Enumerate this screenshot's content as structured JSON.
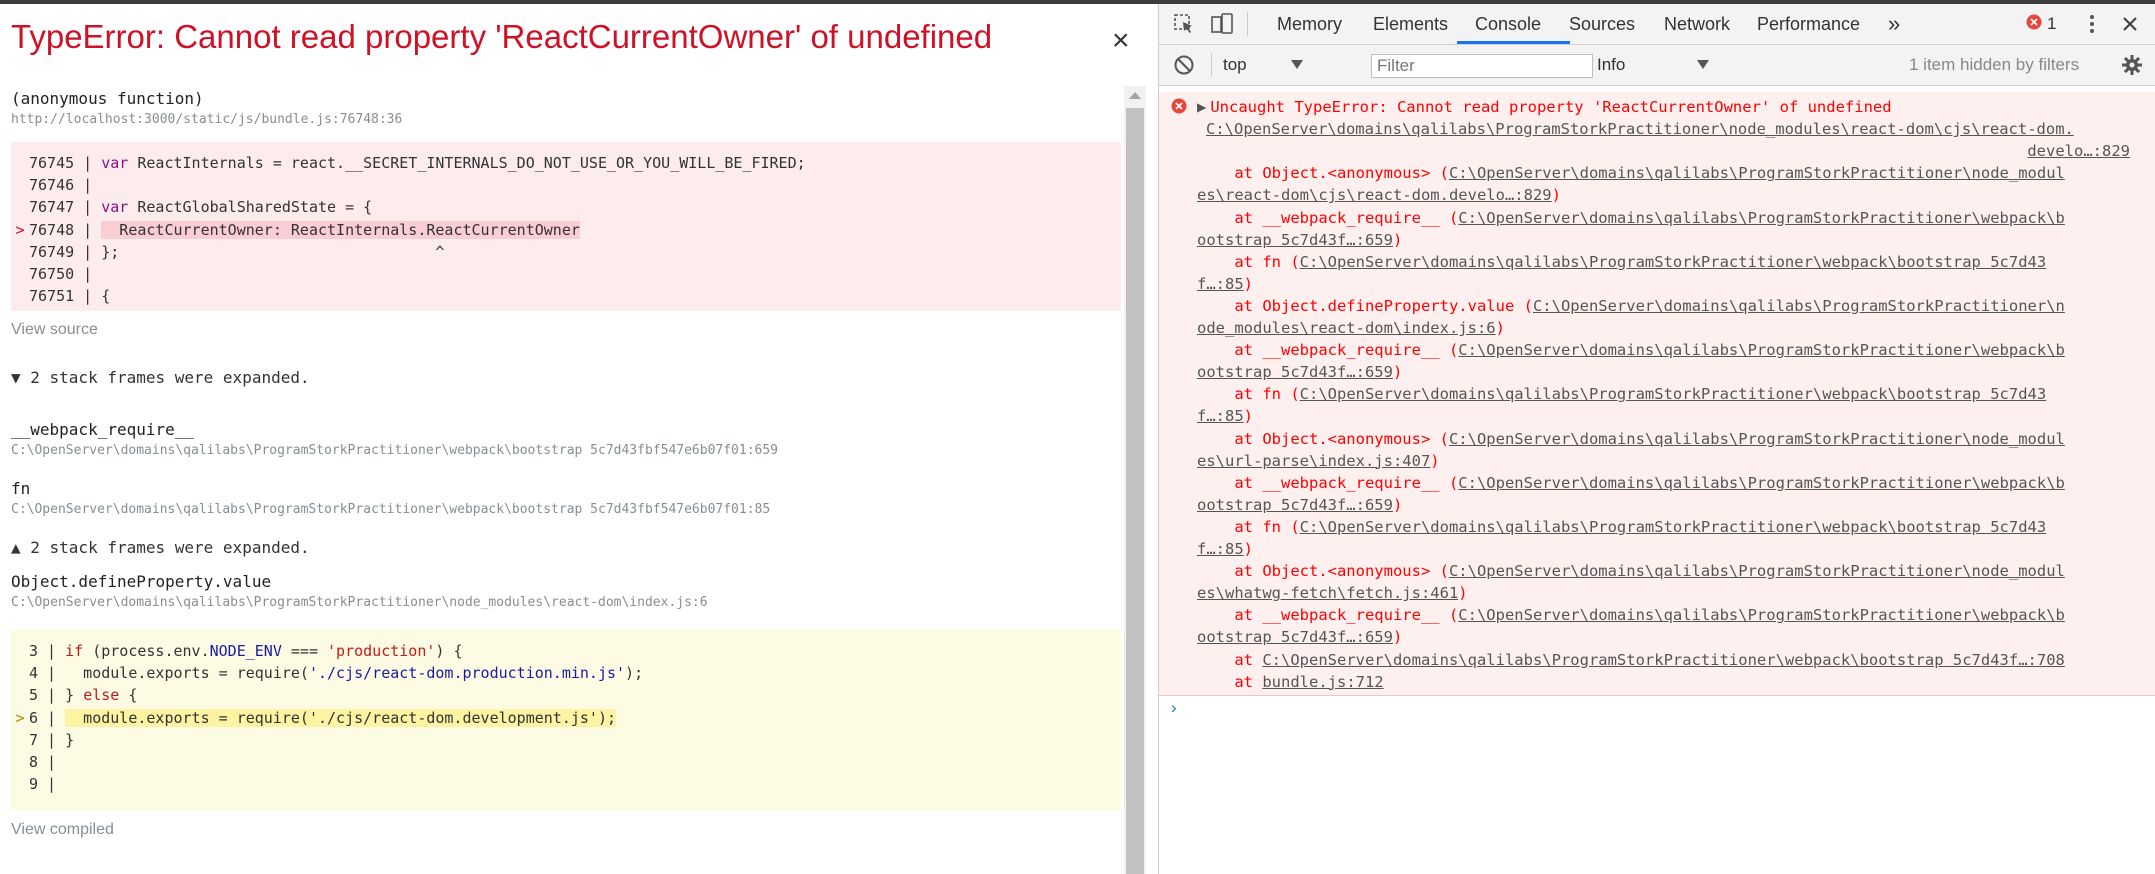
{
  "overlay": {
    "title": "TypeError: Cannot read property 'ReactCurrentOwner' of undefined",
    "close_label": "×",
    "top_frame": {
      "function": "(anonymous function)",
      "location": "http://localhost:3000/static/js/bundle.js:76748:36"
    },
    "code1": {
      "lines": [
        {
          "marker": "",
          "num": "76745",
          "code": [
            {
              "t": "var",
              "c": "kw"
            },
            {
              "t": " ReactInternals = react.__SECRET_INTERNALS_DO_NOT_USE_OR_YOU_WILL_BE_FIRED;",
              "c": ""
            }
          ]
        },
        {
          "marker": "",
          "num": "76746",
          "code": []
        },
        {
          "marker": "",
          "num": "76747",
          "code": [
            {
              "t": "var",
              "c": "kw"
            },
            {
              "t": " ReactGlobalSharedState = {",
              "c": ""
            }
          ]
        },
        {
          "marker": ">",
          "num": "76748",
          "code": [
            {
              "t": "  ReactCurrentOwner: ReactInternals.ReactCurrentOwner",
              "c": "hl-red"
            }
          ]
        },
        {
          "marker": "",
          "num": "76749",
          "code": [
            {
              "t": "};                                   ^",
              "c": ""
            }
          ]
        },
        {
          "marker": "",
          "num": "76750",
          "code": []
        },
        {
          "marker": "",
          "num": "76751",
          "code": [
            {
              "t": "{",
              "c": ""
            }
          ]
        }
      ]
    },
    "view_source": "View source",
    "toggle1": "▼ 2 stack frames were expanded.",
    "frames_expanded": [
      {
        "function": "__webpack_require__",
        "location": "C:\\OpenServer\\domains\\qalilabs\\ProgramStorkPractitioner\\webpack\\bootstrap 5c7d43fbf547e6b07f01:659"
      },
      {
        "function": "fn",
        "location": "C:\\OpenServer\\domains\\qalilabs\\ProgramStorkPractitioner\\webpack\\bootstrap 5c7d43fbf547e6b07f01:85"
      }
    ],
    "toggle2": "▲ 2 stack frames were expanded.",
    "frame3": {
      "function": "Object.defineProperty.value",
      "location": "C:\\OpenServer\\domains\\qalilabs\\ProgramStorkPractitioner\\node_modules\\react-dom\\index.js:6"
    },
    "code2": {
      "lines": [
        {
          "marker": "",
          "num": "3",
          "code": [
            {
              "t": "if",
              "c": "kw-r"
            },
            {
              "t": " (process.env.",
              "c": ""
            },
            {
              "t": "NODE_ENV",
              "c": "str"
            },
            {
              "t": " === ",
              "c": ""
            },
            {
              "t": "'production'",
              "c": "kw-r"
            },
            {
              "t": ") {",
              "c": ""
            }
          ]
        },
        {
          "marker": "",
          "num": "4",
          "code": [
            {
              "t": "  module.exports = require(",
              "c": ""
            },
            {
              "t": "'./cjs/react-dom.production.min.js'",
              "c": "str"
            },
            {
              "t": ");",
              "c": ""
            }
          ]
        },
        {
          "marker": "",
          "num": "5",
          "code": [
            {
              "t": "} ",
              "c": ""
            },
            {
              "t": "else",
              "c": "kw-r"
            },
            {
              "t": " {",
              "c": ""
            }
          ]
        },
        {
          "marker": ">",
          "num": "6",
          "code": [
            {
              "t": "  module.exports = require('./cjs/react-dom.development.js');",
              "c": "hl-yel"
            }
          ]
        },
        {
          "marker": "",
          "num": "7",
          "code": [
            {
              "t": "}",
              "c": ""
            }
          ]
        },
        {
          "marker": "",
          "num": "8",
          "code": []
        },
        {
          "marker": "",
          "num": "9",
          "code": []
        }
      ]
    },
    "view_compiled": "View compiled"
  },
  "devtools": {
    "tabs": [
      {
        "label": "Memory",
        "active": false
      },
      {
        "label": "Elements",
        "active": false
      },
      {
        "label": "Console",
        "active": true
      },
      {
        "label": "Sources",
        "active": false
      },
      {
        "label": "Network",
        "active": false
      },
      {
        "label": "Performance",
        "active": false
      }
    ],
    "more_tabs": "»",
    "error_count": "1",
    "toolbar": {
      "context": "top",
      "filter_placeholder": "Filter",
      "level": "Info",
      "hidden_note": "1 item hidden by filters"
    },
    "console": {
      "lines": [
        [
          {
            "t": "▶",
            "k": "tri"
          },
          {
            "t": "Uncaught TypeError: Cannot read property 'ReactCurrentOwner' of undefined",
            "k": "txt"
          }
        ],
        [
          {
            "t": "C:\\OpenServer\\domains\\qalilabs\\ProgramStorkPractitioner\\node_modules\\react-dom\\cjs\\react-dom.",
            "k": "link"
          }
        ],
        [
          {
            "t": "develo…:829",
            "k": "link-r"
          }
        ],
        [
          {
            "t": "    at Object.<anonymous> (",
            "k": "txt"
          },
          {
            "t": "C:\\OpenServer\\domains\\qalilabs\\ProgramStorkPractitioner\\node_modul",
            "k": "link"
          }
        ],
        [
          {
            "t": "es\\react-dom\\cjs\\react-dom.develo…:829",
            "k": "link"
          },
          {
            "t": ")",
            "k": "txt"
          }
        ],
        [
          {
            "t": "    at __webpack_require__ (",
            "k": "txt"
          },
          {
            "t": "C:\\OpenServer\\domains\\qalilabs\\ProgramStorkPractitioner\\webpack\\b",
            "k": "link"
          }
        ],
        [
          {
            "t": "ootstrap 5c7d43f…:659",
            "k": "link"
          },
          {
            "t": ")",
            "k": "txt"
          }
        ],
        [
          {
            "t": "    at fn (",
            "k": "txt"
          },
          {
            "t": "C:\\OpenServer\\domains\\qalilabs\\ProgramStorkPractitioner\\webpack\\bootstrap 5c7d43",
            "k": "link"
          }
        ],
        [
          {
            "t": "f…:85",
            "k": "link"
          },
          {
            "t": ")",
            "k": "txt"
          }
        ],
        [
          {
            "t": "    at Object.defineProperty.value (",
            "k": "txt"
          },
          {
            "t": "C:\\OpenServer\\domains\\qalilabs\\ProgramStorkPractitioner\\n",
            "k": "link"
          }
        ],
        [
          {
            "t": "ode_modules\\react-dom\\index.js:6",
            "k": "link"
          },
          {
            "t": ")",
            "k": "txt"
          }
        ],
        [
          {
            "t": "    at __webpack_require__ (",
            "k": "txt"
          },
          {
            "t": "C:\\OpenServer\\domains\\qalilabs\\ProgramStorkPractitioner\\webpack\\b",
            "k": "link"
          }
        ],
        [
          {
            "t": "ootstrap 5c7d43f…:659",
            "k": "link"
          },
          {
            "t": ")",
            "k": "txt"
          }
        ],
        [
          {
            "t": "    at fn (",
            "k": "txt"
          },
          {
            "t": "C:\\OpenServer\\domains\\qalilabs\\ProgramStorkPractitioner\\webpack\\bootstrap 5c7d43",
            "k": "link"
          }
        ],
        [
          {
            "t": "f…:85",
            "k": "link"
          },
          {
            "t": ")",
            "k": "txt"
          }
        ],
        [
          {
            "t": "    at Object.<anonymous> (",
            "k": "txt"
          },
          {
            "t": "C:\\OpenServer\\domains\\qalilabs\\ProgramStorkPractitioner\\node_modul",
            "k": "link"
          }
        ],
        [
          {
            "t": "es\\url-parse\\index.js:407",
            "k": "link"
          },
          {
            "t": ")",
            "k": "txt"
          }
        ],
        [
          {
            "t": "    at __webpack_require__ (",
            "k": "txt"
          },
          {
            "t": "C:\\OpenServer\\domains\\qalilabs\\ProgramStorkPractitioner\\webpack\\b",
            "k": "link"
          }
        ],
        [
          {
            "t": "ootstrap 5c7d43f…:659",
            "k": "link"
          },
          {
            "t": ")",
            "k": "txt"
          }
        ],
        [
          {
            "t": "    at fn (",
            "k": "txt"
          },
          {
            "t": "C:\\OpenServer\\domains\\qalilabs\\ProgramStorkPractitioner\\webpack\\bootstrap 5c7d43",
            "k": "link"
          }
        ],
        [
          {
            "t": "f…:85",
            "k": "link"
          },
          {
            "t": ")",
            "k": "txt"
          }
        ],
        [
          {
            "t": "    at Object.<anonymous> (",
            "k": "txt"
          },
          {
            "t": "C:\\OpenServer\\domains\\qalilabs\\ProgramStorkPractitioner\\node_modul",
            "k": "link"
          }
        ],
        [
          {
            "t": "es\\whatwg-fetch\\fetch.js:461",
            "k": "link"
          },
          {
            "t": ")",
            "k": "txt"
          }
        ],
        [
          {
            "t": "    at __webpack_require__ (",
            "k": "txt"
          },
          {
            "t": "C:\\OpenServer\\domains\\qalilabs\\ProgramStorkPractitioner\\webpack\\b",
            "k": "link"
          }
        ],
        [
          {
            "t": "ootstrap 5c7d43f…:659",
            "k": "link"
          },
          {
            "t": ")",
            "k": "txt"
          }
        ],
        [
          {
            "t": "    at ",
            "k": "txt"
          },
          {
            "t": "C:\\OpenServer\\domains\\qalilabs\\ProgramStorkPractitioner\\webpack\\bootstrap 5c7d43f…:708",
            "k": "link"
          }
        ],
        [
          {
            "t": "    at ",
            "k": "txt"
          },
          {
            "t": "bundle.js:712",
            "k": "link"
          }
        ]
      ]
    },
    "prompt": "›"
  },
  "colors": {
    "error_red": "#ce1126",
    "console_red": "#ff0000",
    "active_tab": "#1a73e8"
  }
}
